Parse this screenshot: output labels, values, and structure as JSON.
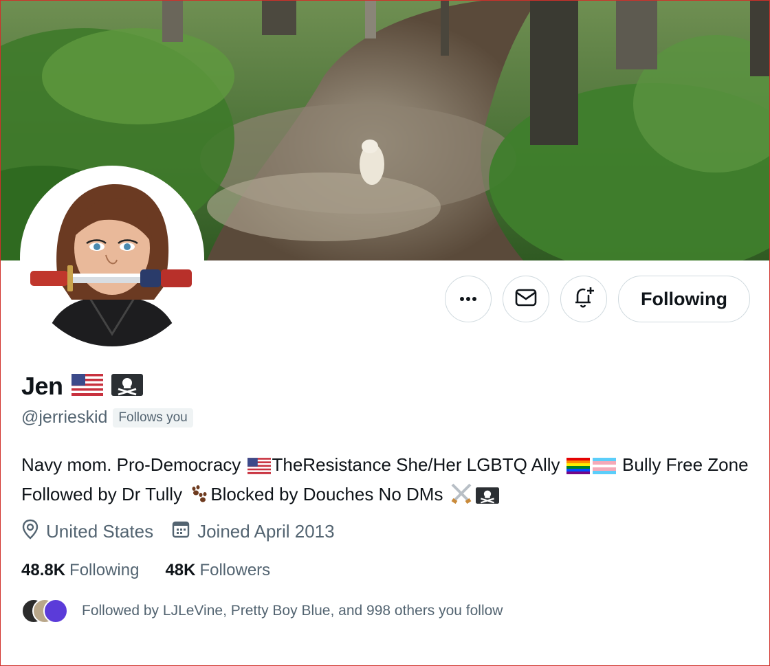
{
  "profile": {
    "display_name": "Jen",
    "handle": "@jerrieskid",
    "follows_you_badge": "Follows you",
    "name_emojis": [
      "us-flag-icon",
      "skull-crossbones-icon"
    ]
  },
  "actions": {
    "more_icon": "more-icon",
    "message_icon": "mail-icon",
    "notify_icon": "bell-plus-icon",
    "follow_label": "Following"
  },
  "bio": {
    "part1": "Navy mom. Pro-Democracy ",
    "part2": "TheResistance She/Her LGBTQ Ally ",
    "part3": " Bully Free Zone Followed by Dr Tully ",
    "part4": "Blocked by Douches No DMs "
  },
  "meta": {
    "location": "United States",
    "joined": "Joined April 2013"
  },
  "stats": {
    "following_count": "48.8K",
    "following_label": "Following",
    "followers_count": "48K",
    "followers_label": "Followers"
  },
  "followed_by": {
    "text": "Followed by LJLeVine, Pretty Boy Blue, and 998 others you follow"
  },
  "colors": {
    "text_primary": "#0f1419",
    "text_secondary": "#536471",
    "border": "#cfd9de"
  }
}
